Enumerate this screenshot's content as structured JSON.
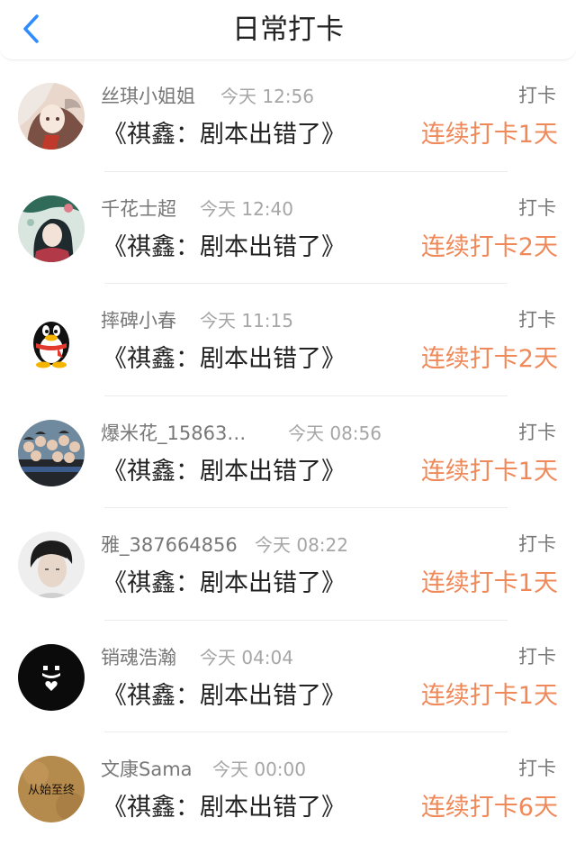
{
  "header": {
    "title": "日常打卡",
    "back_icon": "chevron-left-icon",
    "accent": "#2f8cff"
  },
  "colors": {
    "streak": "#f0895a",
    "name": "#777777",
    "time": "#a6a6a6"
  },
  "items": [
    {
      "name": "丝琪小姐姐",
      "time": "今天 12:56",
      "action": "打卡",
      "content": "《祺鑫：剧本出错了》",
      "streak": "连续打卡1天",
      "avatar": "anime-girl-avatar"
    },
    {
      "name": "千花士超",
      "time": "今天 12:40",
      "action": "打卡",
      "content": "《祺鑫：剧本出错了》",
      "streak": "连续打卡2天",
      "avatar": "illustrated-girl-avatar"
    },
    {
      "name": "摔碑小春",
      "time": "今天 11:15",
      "action": "打卡",
      "content": "《祺鑫：剧本出错了》",
      "streak": "连续打卡2天",
      "avatar": "qq-penguin-avatar"
    },
    {
      "name": "爆米花_15863…",
      "time": "今天 08:56",
      "action": "打卡",
      "content": "《祺鑫：剧本出错了》",
      "streak": "连续打卡1天",
      "avatar": "group-photo-avatar"
    },
    {
      "name": "雅_387664856",
      "time": "今天 08:22",
      "action": "打卡",
      "content": "《祺鑫：剧本出错了》",
      "streak": "连续打卡1天",
      "avatar": "portrait-avatar"
    },
    {
      "name": "销魂浩瀚",
      "time": "今天 04:04",
      "action": "打卡",
      "content": "《祺鑫：剧本出错了》",
      "streak": "连续打卡1天",
      "avatar": "black-heart-avatar"
    },
    {
      "name": "文康Sama",
      "time": "今天 00:00",
      "action": "打卡",
      "content": "《祺鑫：剧本出错了》",
      "streak": "连续打卡6天",
      "avatar": "text-avatar",
      "avatar_text": "从始至终"
    }
  ]
}
